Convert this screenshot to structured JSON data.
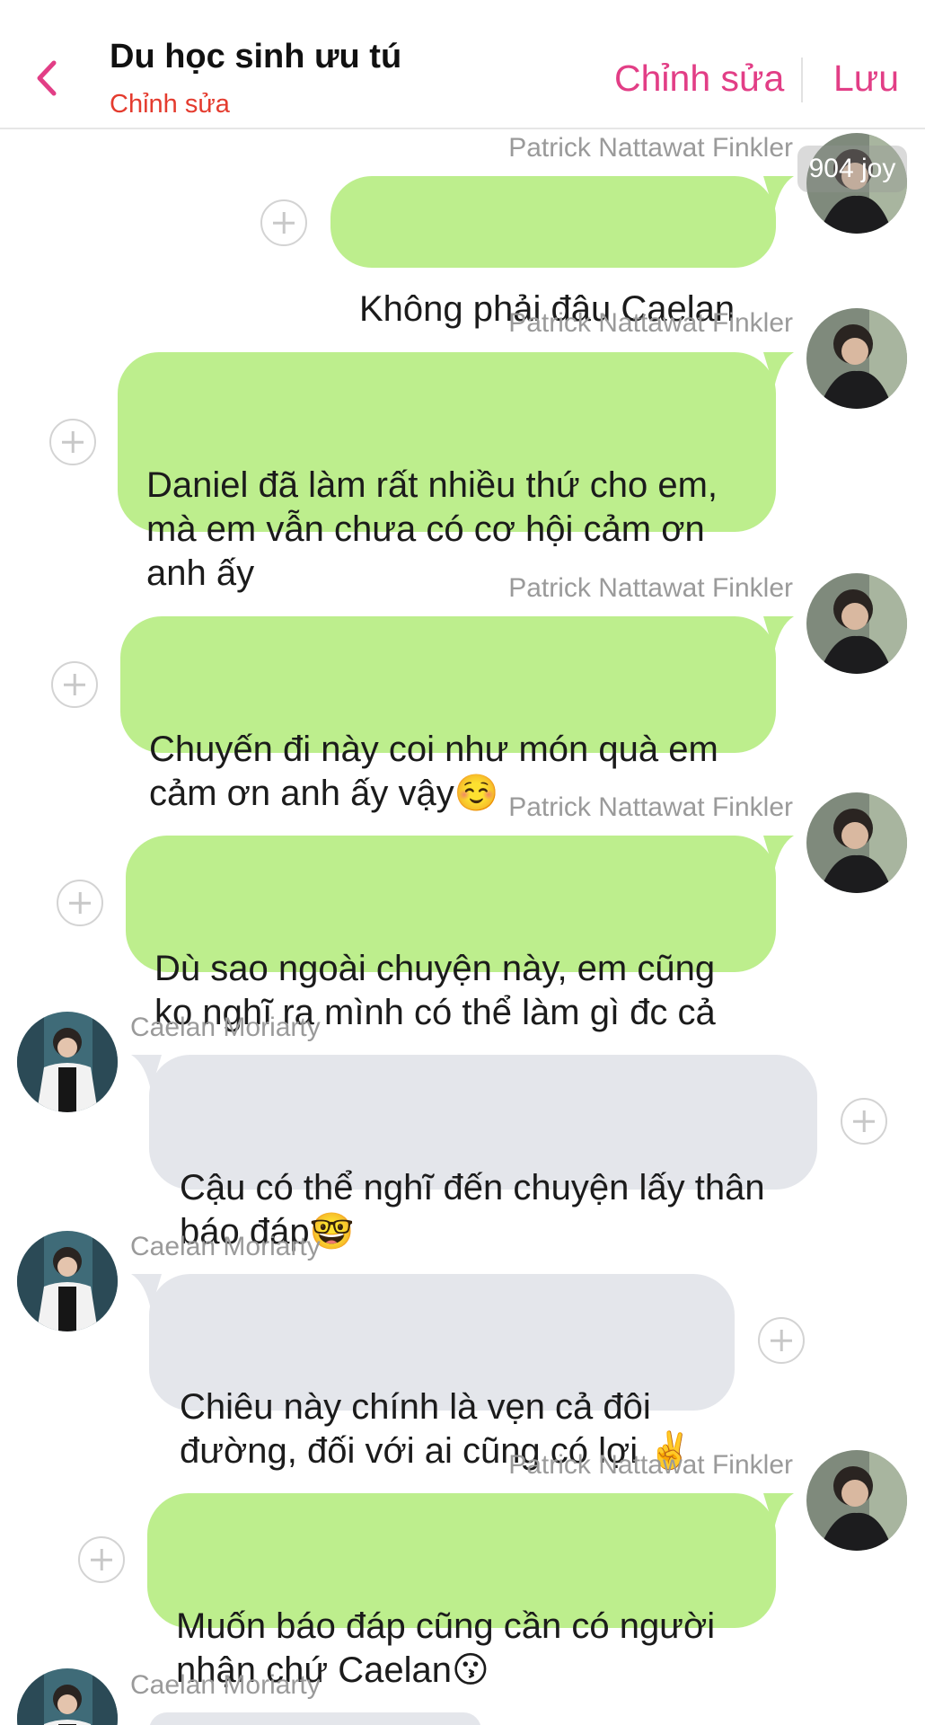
{
  "header": {
    "title": "Du học sinh ưu tú",
    "subtitle": "Chỉnh sửa",
    "edit_label": "Chỉnh sửa",
    "save_label": "Lưu"
  },
  "watermark": "904 joy",
  "colors": {
    "accent": "#e23e86",
    "subtitle": "#e43b2e",
    "bubble_outgoing": "#bdee8d",
    "bubble_incoming": "#e4e6eb"
  },
  "messages": [
    {
      "sender": "Patrick Nattawat Finkler",
      "text": "Không phải đâu Caelan",
      "side": "right"
    },
    {
      "sender": "Patrick Nattawat Finkler",
      "text": "Daniel đã làm rất nhiều thứ cho em,\nmà em vẫn chưa có cơ hội cảm ơn\nanh ấy",
      "side": "right"
    },
    {
      "sender": "Patrick Nattawat Finkler",
      "text": "Chuyến đi này coi như món quà em\ncảm ơn anh ấy vậy☺️",
      "side": "right"
    },
    {
      "sender": "Patrick Nattawat Finkler",
      "text": "Dù sao ngoài chuyện này, em cũng\nko nghĩ ra mình có thể làm gì đc cả",
      "side": "right"
    },
    {
      "sender": "Caelan Moriarty",
      "text": "Cậu có thể nghĩ đến chuyện lấy thân\nbáo đáp🤓",
      "side": "left"
    },
    {
      "sender": "Caelan Moriarty",
      "text": "Chiêu này chính là vẹn cả đôi\nđường, đối với ai cũng có lợi ✌️",
      "side": "left"
    },
    {
      "sender": "Patrick Nattawat Finkler",
      "text": "Muốn báo đáp cũng cần có người\nnhận chứ Caelan😗",
      "side": "right"
    },
    {
      "sender": "Caelan Moriarty",
      "text": "",
      "side": "left"
    }
  ]
}
